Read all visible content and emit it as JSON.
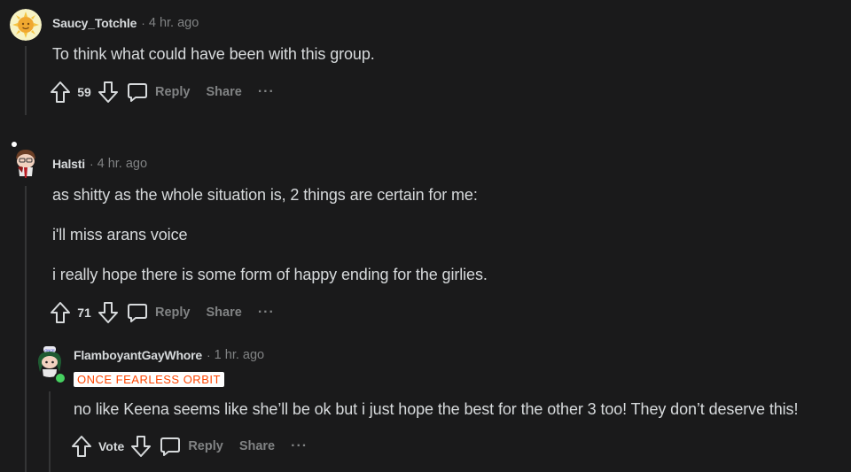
{
  "comments": [
    {
      "username": "Saucy_Totchle",
      "time": "4 hr. ago",
      "body": [
        "To think what could have been with this group."
      ],
      "score": "59",
      "reply_label": "Reply",
      "share_label": "Share",
      "more_label": "···",
      "avatar": "sun-avatar"
    },
    {
      "username": "Halsti",
      "time": "4 hr. ago",
      "body": [
        "as shitty as the whole situation is, 2 things are certain for me:",
        "i'll miss arans voice",
        "i really hope there is some form of happy ending for the girlies."
      ],
      "score": "71",
      "reply_label": "Reply",
      "share_label": "Share",
      "more_label": "···",
      "avatar": "snoo-avatar-scarf"
    },
    {
      "username": "FlamboyantGayWhore",
      "time": "1 hr. ago",
      "flair": "ONCE FEARLESS ORBIT",
      "body": [
        "no like Keena seems like she’ll be ok but i just hope the best for the other 3 too! They don’t deserve this!"
      ],
      "score": "Vote",
      "reply_label": "Reply",
      "share_label": "Share",
      "more_label": "···",
      "online": true,
      "avatar": "snoo-avatar-green-hair"
    }
  ],
  "colors": {
    "background": "#1a1a1b",
    "text": "#d7dadc",
    "muted": "#818384",
    "thread_line": "#343536",
    "flair_text": "#ff4500",
    "flair_bg": "#ffffff",
    "online": "#46d160"
  },
  "separator": "·"
}
